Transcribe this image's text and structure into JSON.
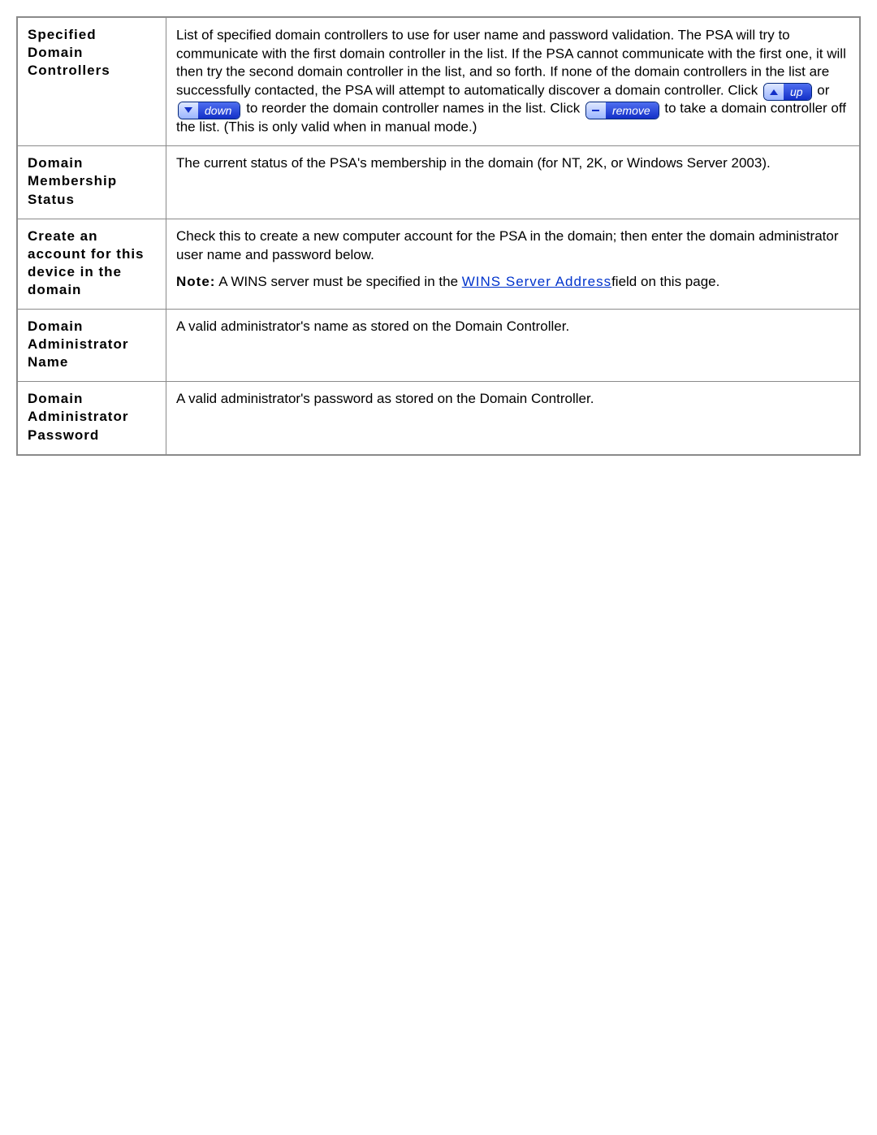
{
  "buttons": {
    "up": "up",
    "down": "down",
    "remove": "remove"
  },
  "rows": {
    "r1": {
      "term": "Specified Domain Controllers",
      "p1": "List of specified domain controllers to use for user name and password validation. The PSA will try to communicate with the first domain controller in the list. If the PSA cannot communicate with the first one, it will then try the second domain controller in the list, and so forth. If none of the domain controllers in the list are successfully contacted, the PSA will attempt to automatically discover a domain controller. Click ",
      "p2": " or ",
      "p3": " to reorder the domain controller names in the list. Click ",
      "p4": " to take a domain controller off the list. (This is only valid when in manual mode.)"
    },
    "r2": {
      "term": "Domain Membership Status",
      "desc": "The current status of the PSA's membership in the domain (for NT, 2K, or Windows Server 2003)."
    },
    "r3": {
      "term": "Create an account for this device in the domain",
      "desc": "Check this to create a new computer account for the PSA in the domain; then enter the domain administrator user name and password below.",
      "note_label": "Note:",
      "note_a": " A WINS server must be specified in the ",
      "link": "WINS Server Address",
      "note_b": "field on this page."
    },
    "r4": {
      "term": "Domain Administrator Name",
      "desc": "A valid administrator's name as stored on the Domain Controller."
    },
    "r5": {
      "term": "Domain Administrator Password",
      "desc": "A valid administrator's password as stored on the Domain Controller."
    }
  }
}
